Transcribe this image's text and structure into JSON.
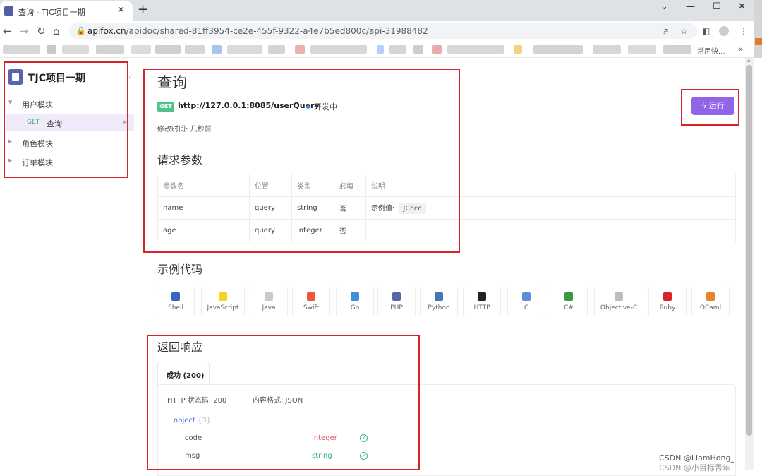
{
  "browser": {
    "tab_title": "查询 - TJC项目一期",
    "tab_close": "✕",
    "new_tab": "+",
    "url_domain": "apifox.cn",
    "url_path": "/apidoc/shared-81ff3954-ce2e-455f-9322-a4e7b5ed800c/api-31988482",
    "bookmark_text": "常用快...",
    "bookmark_more": "»",
    "window_controls": [
      "⌄",
      "—",
      "☐",
      "✕"
    ]
  },
  "sidebar": {
    "project_name": "TJC项目一期",
    "items": [
      {
        "label": "用户模块",
        "expanded": true
      },
      {
        "label": "角色模块",
        "expanded": false
      },
      {
        "label": "订单模块",
        "expanded": false
      }
    ],
    "active_item": {
      "method": "GET",
      "label": "查询"
    }
  },
  "api": {
    "title": "查询",
    "method": "GET",
    "endpoint": "http://127.0.0.1:8085/userQuery",
    "status": "开发中",
    "modified": "修改时间: 几秒前",
    "run_label": "运行"
  },
  "params": {
    "section_title": "请求参数",
    "headers": [
      "参数名",
      "位置",
      "类型",
      "必填",
      "说明"
    ],
    "rows": [
      {
        "name": "name",
        "location": "query",
        "type": "string",
        "required": "否",
        "desc_label": "示例值:",
        "desc_value": "JCccc"
      },
      {
        "name": "age",
        "location": "query",
        "type": "integer",
        "required": "否",
        "desc_label": "",
        "desc_value": ""
      }
    ]
  },
  "code_samples": {
    "section_title": "示例代码",
    "languages": [
      {
        "name": "Shell",
        "color": "#3466c0"
      },
      {
        "name": "JavaScript",
        "color": "#f5d323"
      },
      {
        "name": "Java",
        "color": "#c9c9c9"
      },
      {
        "name": "Swift",
        "color": "#f0553a"
      },
      {
        "name": "Go",
        "color": "#3f8fd8"
      },
      {
        "name": "PHP",
        "color": "#5867a8"
      },
      {
        "name": "Python",
        "color": "#3f7ab5"
      },
      {
        "name": "HTTP",
        "color": "#222222"
      },
      {
        "name": "C",
        "color": "#5b8ed6"
      },
      {
        "name": "C#",
        "color": "#3a9a3f"
      },
      {
        "name": "Objective-C",
        "color": "#bdbdbd"
      },
      {
        "name": "Ruby",
        "color": "#d82424"
      },
      {
        "name": "OCaml",
        "color": "#e8832a"
      }
    ]
  },
  "responses": {
    "section_title": "返回响应",
    "tab_label": "成功 (200)",
    "http_code": "HTTP 状态码: 200",
    "format": "内容格式: JSON",
    "schema_type": "object",
    "schema_count": "{3}",
    "fields": [
      {
        "name": "code",
        "type": "integer",
        "type_color": "#e2566b"
      },
      {
        "name": "msg",
        "type": "string",
        "type_color": "#37b37c"
      }
    ]
  },
  "watermark": {
    "line1": "CSDN @LiamHong_",
    "line2": "CSDN @小目标青年"
  }
}
